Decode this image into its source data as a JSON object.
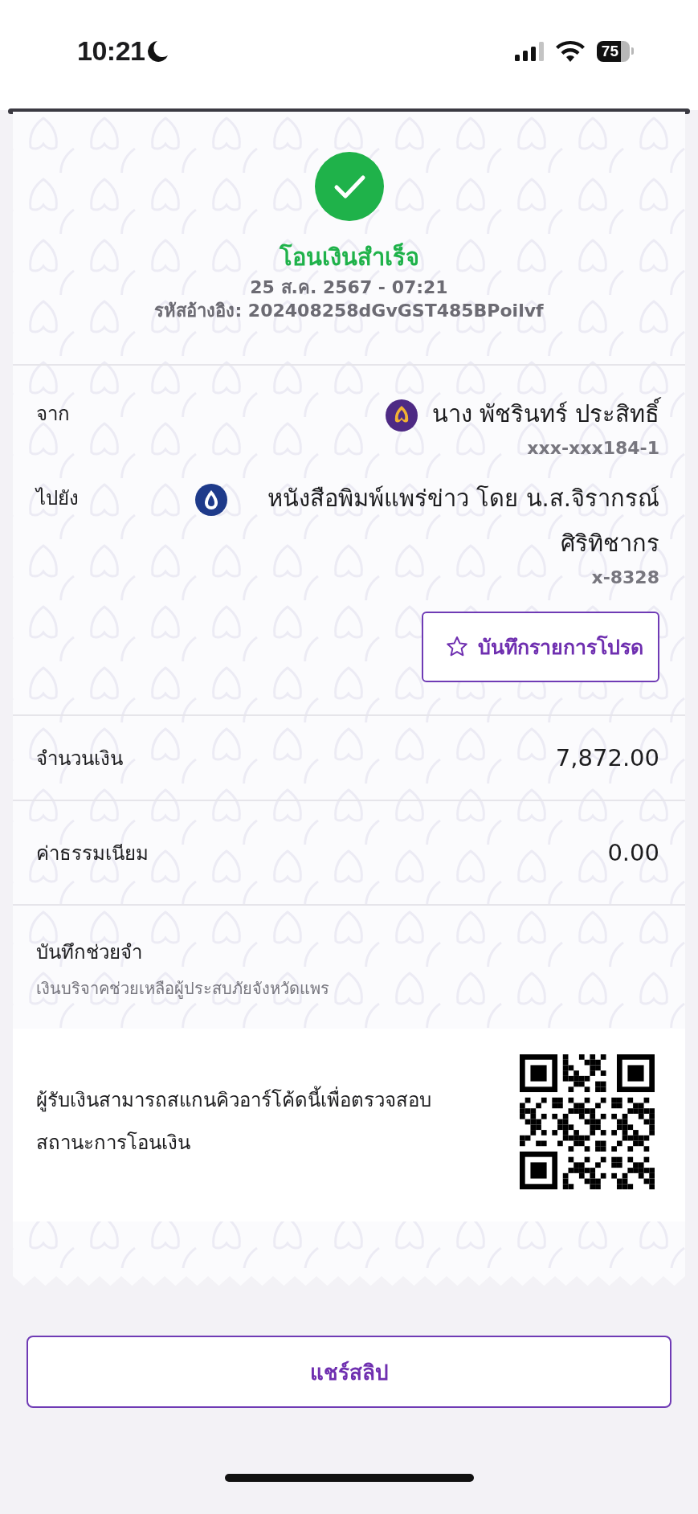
{
  "status_bar": {
    "time": "10:21",
    "battery": "75"
  },
  "receipt": {
    "status": "โอนเงินสำเร็จ",
    "date": "25 ส.ค. 2567 - 07:21",
    "reference": "รหัสอ้างอิง: 202408258dGvGST485BPoilvf",
    "from": {
      "label": "จาก",
      "name": "นาง พัชรินทร์ ประสิทธิ์",
      "account": "xxx-xxx184-1"
    },
    "to": {
      "label": "ไปยัง",
      "name": "หนังสือพิมพ์แพร่ข่าว โดย น.ส.จิรากรณ์ ศิริทิชากร",
      "account": "x-8328"
    },
    "favorite_button": "บันทึกรายการโปรด",
    "amount": {
      "label": "จำนวนเงิน",
      "value": "7,872.00"
    },
    "fee": {
      "label": "ค่าธรรมเนียม",
      "value": "0.00"
    },
    "memo": {
      "label": "บันทึกช่วยจำ",
      "text": "เงินบริจาคช่วยเหลือผู้ประสบภัยจังหวัดแพร"
    },
    "qr_note": "ผู้รับเงินสามารถสแกนคิวอาร์โค้ดนี้เพื่อตรวจสอบสถานะการโอนเงิน"
  },
  "share_button": "แชร์สลิป"
}
